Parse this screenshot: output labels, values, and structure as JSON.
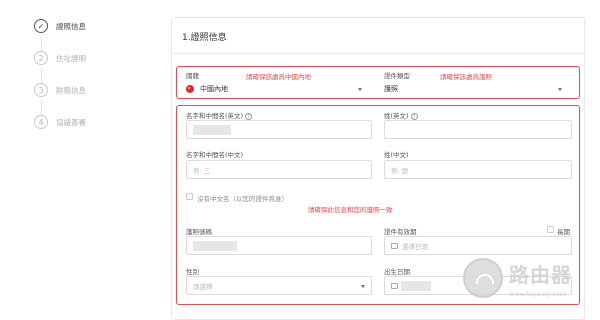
{
  "steps": [
    {
      "index": "✓",
      "label": "證照信息",
      "state": "done"
    },
    {
      "index": "2",
      "label": "住址證明",
      "state": "pending"
    },
    {
      "index": "3",
      "label": "財務信息",
      "state": "pending"
    },
    {
      "index": "4",
      "label": "協議簽署",
      "state": "pending"
    }
  ],
  "card": {
    "title": "1.證照信息"
  },
  "region": {
    "label": "國籍",
    "value": "中國內地",
    "note": "請確保該處爲中國內地"
  },
  "doc_type": {
    "label": "證件類型",
    "value": "護照",
    "note": "請確保該處爲護照"
  },
  "name_en": {
    "label": "名字和中間名(英文)",
    "help": "?"
  },
  "surname_en": {
    "label": "姓(英文)",
    "help": "?"
  },
  "name_cn": {
    "label": "名字和中間名(中文)",
    "placeholder": "例: 三"
  },
  "surname_cn": {
    "label": "姓(中文)",
    "placeholder": "例: 張"
  },
  "no_chinese": {
    "label": "沒有中文名（以您的證件爲准）"
  },
  "consistency_note": "請確保此信息和您的護照一致",
  "passport_no": {
    "label": "護照號碼"
  },
  "validity": {
    "label": "證件有效期",
    "placeholder": "選擇日期",
    "long_term": "長期"
  },
  "gender": {
    "label": "性別",
    "placeholder": "請選擇"
  },
  "birth": {
    "label": "出生日期"
  },
  "watermark": {
    "cn": "路由器",
    "url": "www.luyouqi.com"
  },
  "colors": {
    "accent_red": "#e5484d"
  }
}
